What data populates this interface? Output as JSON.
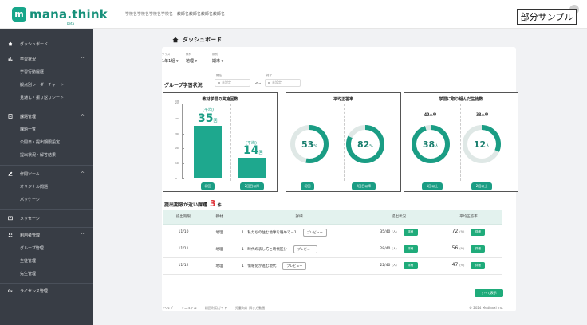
{
  "header": {
    "logo_badge": "m",
    "logo_text": "mana.think",
    "logo_sub": "beta",
    "school_info": "学校名学校名学校名学校名　教師名教師名教師名教師名",
    "sample_label": "部分サンプル"
  },
  "sidebar": {
    "dashboard": "ダッシュボード",
    "learning_status": "学習状況",
    "learning_subs": [
      "学習行動履歴",
      "観点別レーダーチャート",
      "見通し・振り返りシート"
    ],
    "task_mgmt": "課題管理",
    "task_subs": [
      "課題一覧",
      "公開日・提出期限設定",
      "提出状況・解答結果"
    ],
    "tools": "作問ツール",
    "tool_subs": [
      "オリジナル問題",
      "パッケージ"
    ],
    "messages": "メッセージ",
    "user_mgmt": "利用者管理",
    "user_subs": [
      "グループ管理",
      "生徒管理",
      "先生管理"
    ],
    "license": "ライセンス管理"
  },
  "page": {
    "title": "ダッシュボード"
  },
  "filters": {
    "class_label": "クラス",
    "class_value": "1年1組",
    "subject_label": "教科",
    "subject_value": "地理",
    "period_label": "期別",
    "period_value": "期末",
    "group_status": "グループ学習状況",
    "start_label": "開始",
    "start_placeholder": "未設定",
    "end_label": "終了",
    "end_placeholder": "未設定",
    "tilde": "〜"
  },
  "panels": {
    "practice": {
      "title": "教材学習の実施回数",
      "y_unit": "(回)",
      "first_avg": "(平均)",
      "first_value": "35",
      "second_avg": "(平均)",
      "second_value": "14",
      "unit": "回",
      "first_label": "初回",
      "second_label": "2回目以降"
    },
    "accuracy": {
      "title": "平均正答率",
      "first_value": "53",
      "second_value": "82",
      "unit": "%",
      "first_label": "初回",
      "second_label": "2回目以降"
    },
    "students": {
      "title": "学習に取り組んだ生徒数",
      "first_caption": "40人中",
      "second_caption": "38人中",
      "first_value": "38",
      "second_value": "12",
      "unit": "人",
      "first_label": "1回以上",
      "second_label": "2回以上"
    }
  },
  "chart_data": [
    {
      "type": "bar",
      "title": "教材学習の実施回数",
      "ylabel": "(回)",
      "categories": [
        "初回",
        "2回目以降"
      ],
      "values": [
        35,
        14
      ],
      "ylim": [
        0,
        50
      ],
      "yticks": [
        "50",
        "40",
        "30",
        "20",
        "10",
        "0"
      ]
    },
    {
      "type": "pie",
      "title": "平均正答率",
      "categories": [
        "初回",
        "2回目以降"
      ],
      "values": [
        53,
        82
      ]
    },
    {
      "type": "pie",
      "title": "学習に取り組んだ生徒数",
      "categories": [
        "1回以上",
        "2回以上"
      ],
      "values": [
        38,
        12
      ],
      "totals": [
        40,
        38
      ]
    }
  ],
  "tasks": {
    "heading": "提出期限が近い課題",
    "count": "3",
    "count_unit": "件",
    "columns": [
      "提出期限",
      "教材",
      "詳細",
      "提出状況",
      "平均正答率"
    ],
    "preview_label": "プレビュー",
    "detail_label": "詳細",
    "rows": [
      {
        "deadline": "11/10",
        "material": "地理",
        "detail": "1　私たちの住む地球を眺めて－1",
        "status": "35/40",
        "status_unit": "(人)",
        "rate": "72",
        "rate_unit": "(%)"
      },
      {
        "deadline": "11/11",
        "material": "地理",
        "detail": "1　時代の表し方と時代区分",
        "status": "28/40",
        "status_unit": "(人)",
        "rate": "56",
        "rate_unit": "(%)"
      },
      {
        "deadline": "11/12",
        "material": "地理",
        "detail": "1　情報化が進む現代",
        "status": "22/40",
        "status_unit": "(人)",
        "rate": "47",
        "rate_unit": "(%)"
      }
    ],
    "show_all": "すべて表示"
  },
  "footer": {
    "links": [
      "ヘルプ",
      "マニュアル",
      "初回利用ガイド",
      "児童向け 解き方動画"
    ],
    "copyright": "© 2024 MediaxxI Inc."
  },
  "colors": {
    "accent": "#1a9d84",
    "sidebar_bg": "#383d45",
    "count_red": "#e0343a",
    "ring_track": "#dfe8e6"
  }
}
